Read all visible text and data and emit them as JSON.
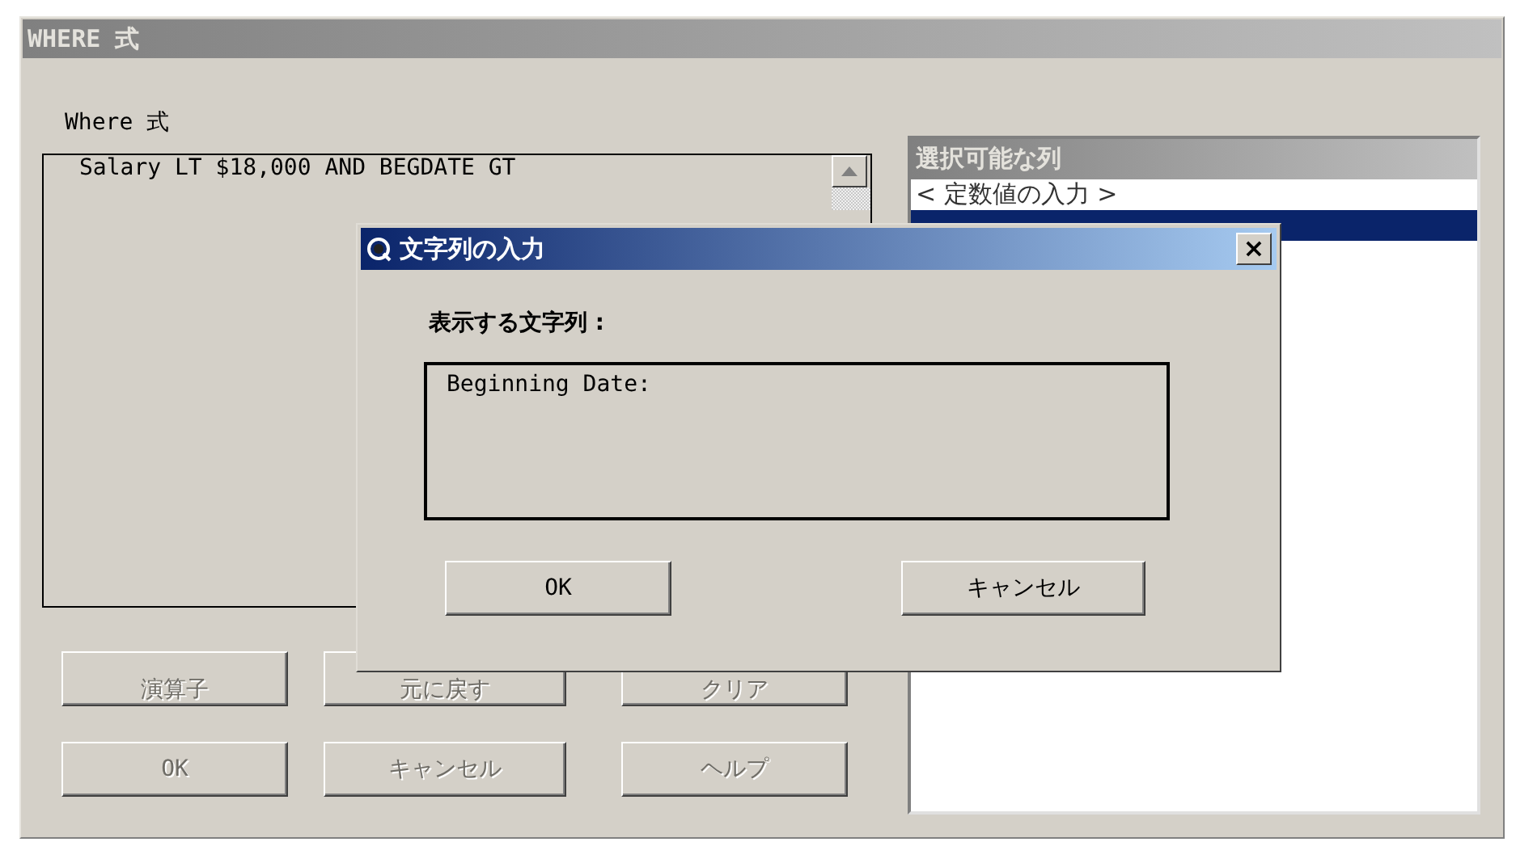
{
  "window": {
    "title": "WHERE 式"
  },
  "expression": {
    "label": "Where 式",
    "value": "Salary LT $18,000 AND BEGDATE GT"
  },
  "columns_list": {
    "title": "選択可能な列",
    "items": [
      {
        "label": "< 定数値の入力 >",
        "selected": false
      },
      {
        "selected": true
      }
    ]
  },
  "buttons": [
    {
      "label": "演算子",
      "disabled": true
    },
    {
      "label": "元に戻す",
      "disabled": true
    },
    {
      "label": "クリア",
      "disabled": true
    },
    {
      "label": "OK",
      "disabled": true
    },
    {
      "label": "キャンセル",
      "disabled": true
    },
    {
      "label": "ヘルプ",
      "disabled": true
    }
  ],
  "dialog": {
    "title": "文字列の入力",
    "close": "×",
    "prompt": "表示する文字列 :",
    "value": "Beginning Date:",
    "buttons": [
      {
        "label": "OK"
      },
      {
        "label": "キャンセル"
      }
    ]
  }
}
